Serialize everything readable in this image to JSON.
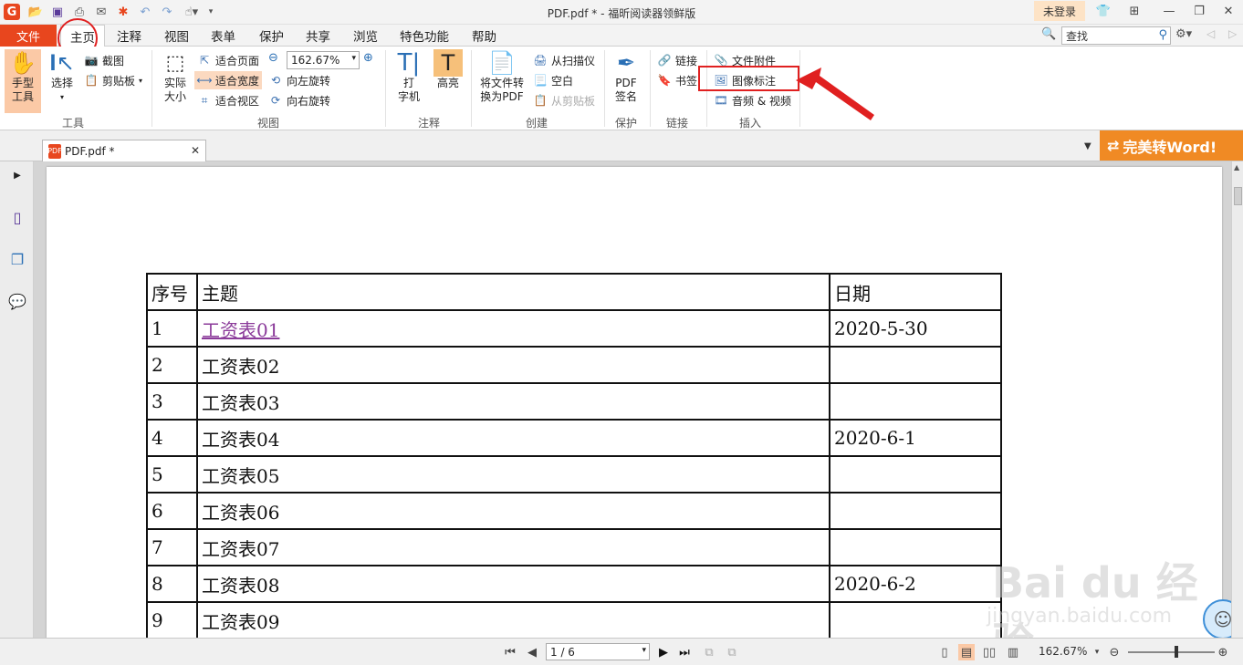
{
  "titlebar": {
    "title": "PDF.pdf * - 福昕阅读器领鲜版",
    "logo": "G",
    "login": "未登录",
    "icons": [
      "open-folder-icon",
      "save-icon",
      "print-icon",
      "email-icon",
      "new-icon",
      "undo-icon",
      "redo-icon",
      "hand-dropdown-icon",
      "customize-icon"
    ]
  },
  "ribbon_tabs": {
    "file": "文件",
    "tabs": [
      "主页",
      "注释",
      "视图",
      "表单",
      "保护",
      "共享",
      "浏览",
      "特色功能",
      "帮助"
    ],
    "active": "主页",
    "search_placeholder": "查找"
  },
  "ribbon": {
    "tools": {
      "hand": "手型\n工具",
      "select": "选择",
      "screenshot": "截图",
      "clipboard": "剪贴板",
      "label": "工具"
    },
    "view": {
      "actual_size": "实际\n大小",
      "fit_page": "适合页面",
      "fit_width": "适合宽度",
      "fit_visible": "适合视区",
      "zoom_value": "162.67%",
      "rotate_left": "向左旋转",
      "rotate_right": "向右旋转",
      "label": "视图"
    },
    "comment": {
      "typewriter": "打\n字机",
      "highlight": "高亮",
      "label": "注释"
    },
    "create": {
      "convert": "将文件转\n换为PDF",
      "from_scanner": "从扫描仪",
      "blank": "空白",
      "from_clipboard": "从剪贴板",
      "label": "创建"
    },
    "protect": {
      "sign": "PDF\n签名",
      "label": "保护"
    },
    "links": {
      "link": "链接",
      "bookmark": "书签",
      "label": "链接"
    },
    "insert": {
      "attachment": "文件附件",
      "image_annotation": "图像标注",
      "audio_video": "音频 & 视频",
      "label": "插入"
    }
  },
  "doc_tabs": {
    "tab_name": "PDF.pdf *",
    "convert_word": "完美转Word!"
  },
  "document": {
    "headers": [
      "序号",
      "主题",
      "日期"
    ],
    "rows": [
      [
        "1",
        "工资表01",
        "2020-5-30"
      ],
      [
        "2",
        "工资表02",
        ""
      ],
      [
        "3",
        "工资表03",
        ""
      ],
      [
        "4",
        "工资表04",
        "2020-6-1"
      ],
      [
        "5",
        "工资表05",
        ""
      ],
      [
        "6",
        "工资表06",
        ""
      ],
      [
        "7",
        "工资表07",
        ""
      ],
      [
        "8",
        "工资表08",
        "2020-6-2"
      ],
      [
        "9",
        "工资表09",
        ""
      ]
    ],
    "watermark": "Bai du 经验",
    "watermark_sub": "jingyan.baidu.com"
  },
  "statusbar": {
    "page": "1 / 6",
    "zoom": "162.67%"
  },
  "colors": {
    "accent": "#e8461e",
    "word_button": "#f08a24",
    "highlight": "#fbd9c0",
    "annotation_red": "#e02020",
    "link_purple": "#8b3b9a"
  }
}
